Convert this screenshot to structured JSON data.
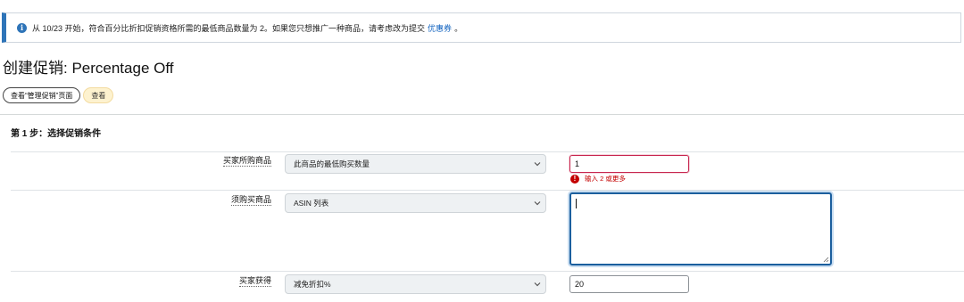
{
  "notice": {
    "text_before": "从 10/23 开始，符合百分比折扣促销资格所需的最低商品数量为 2。如果您只想推广一种商品，请考虑改为提交",
    "link": "优惠券",
    "text_after": "。",
    "icon": "info-icon"
  },
  "page": {
    "title": "创建促销: Percentage Off"
  },
  "buttons": {
    "view_manage": "查看“管理促销”页面",
    "view": "查看"
  },
  "step1": {
    "heading": "第 1 步：选择促销条件",
    "rows": [
      {
        "label": "买家所购商品",
        "select_value": "此商品的最低购买数量",
        "input_value": "1",
        "error": "输入 2 或更多"
      },
      {
        "label": "须购买商品",
        "select_value": "ASIN 列表",
        "textarea_value": ""
      },
      {
        "label": "买家获得",
        "select_value": "减免折扣%",
        "input_value": "20"
      }
    ]
  },
  "colors": {
    "accent": "#2e74b8",
    "error": "#c40000",
    "focus": "#1b5f9e",
    "yellow_pill": "#fdf2cf"
  }
}
